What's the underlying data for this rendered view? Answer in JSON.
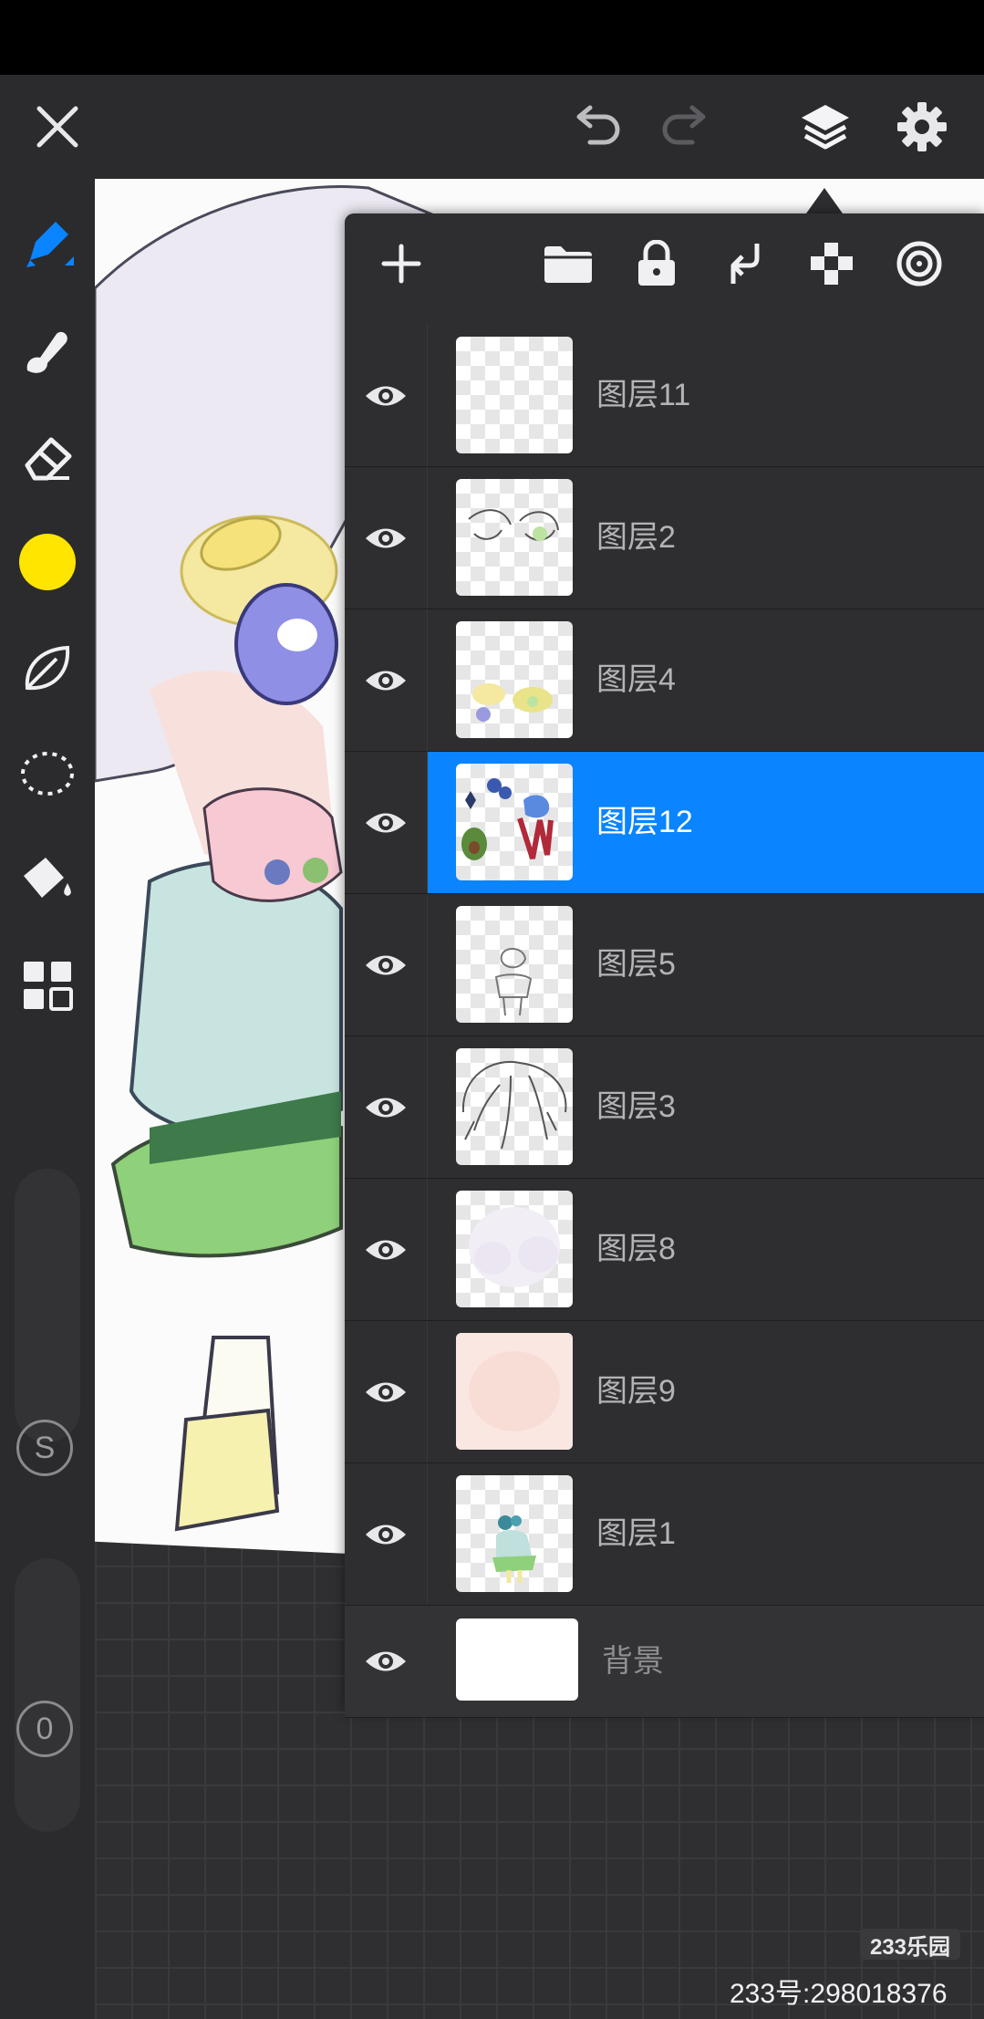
{
  "topbar": {
    "icons": [
      "close-icon",
      "undo-icon",
      "redo-icon",
      "layers-icon",
      "settings-icon"
    ]
  },
  "toolbar": {
    "tools": [
      "pen-icon",
      "smudge-icon",
      "eraser-icon",
      "color-swatch",
      "leaf-brush-icon",
      "lasso-select-icon",
      "fill-bucket-icon",
      "grid-tools-icon"
    ],
    "current_color": "#FFE500",
    "size_label": "S",
    "opacity_label": "0"
  },
  "layer_panel": {
    "tool_icons": [
      "add-icon",
      "folder-icon",
      "lock-icon",
      "merge-down-icon",
      "alpha-lock-icon",
      "clip-icon"
    ],
    "layers": [
      {
        "name": "图层11",
        "visible": true,
        "selected": false
      },
      {
        "name": "图层2",
        "visible": true,
        "selected": false
      },
      {
        "name": "图层4",
        "visible": true,
        "selected": false
      },
      {
        "name": "图层12",
        "visible": true,
        "selected": true
      },
      {
        "name": "图层5",
        "visible": true,
        "selected": false
      },
      {
        "name": "图层3",
        "visible": true,
        "selected": false
      },
      {
        "name": "图层8",
        "visible": true,
        "selected": false
      },
      {
        "name": "图层9",
        "visible": true,
        "selected": false
      },
      {
        "name": "图层1",
        "visible": true,
        "selected": false
      }
    ],
    "background_layer": {
      "name": "背景",
      "visible": true
    }
  },
  "watermark": {
    "logo": "233乐园",
    "id_text": "233号:298018376"
  },
  "colors": {
    "accent": "#0A84FF",
    "panel": "#2E2E30",
    "toolbar": "#2B2B2D"
  }
}
